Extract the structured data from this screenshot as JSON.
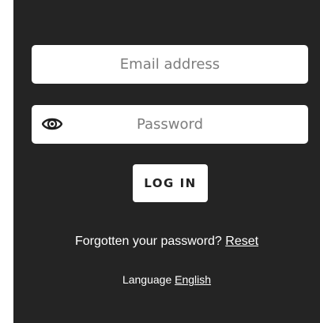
{
  "login": {
    "email_placeholder": "Email address",
    "password_placeholder": "Password",
    "login_label": "LOG IN",
    "forgot_text": "Forgotten your password?",
    "reset_link": "Reset",
    "language_text": "Language",
    "language_link": "English"
  },
  "icons": {
    "password_toggle": "eye-icon"
  },
  "colors": {
    "panel_background": "#242424",
    "field_background": "#ffffff",
    "text_light": "#ffffff",
    "placeholder": "#7d7d7d"
  }
}
